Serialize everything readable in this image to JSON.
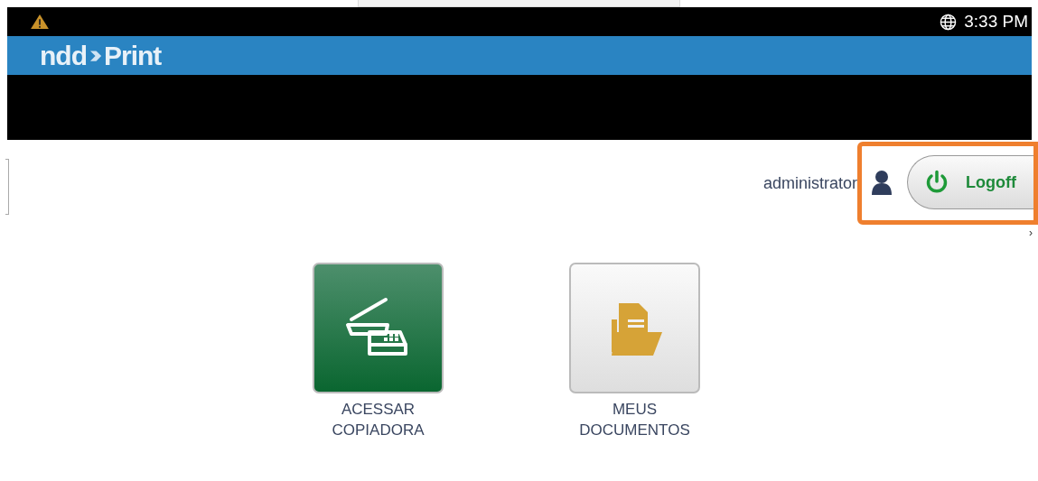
{
  "status_bar": {
    "time": "3:33 PM",
    "warning": true
  },
  "brand": {
    "logo_prefix": "ndd",
    "logo_suffix": "Print"
  },
  "user": {
    "name": "administrator",
    "logoff_label": "Logoff",
    "highlighted": true
  },
  "next_arrow": "›",
  "tiles": [
    {
      "kind": "copier",
      "label_lines": [
        "ACESSAR",
        "COPIADORA"
      ]
    },
    {
      "kind": "documents",
      "label_lines": [
        "MEUS",
        "DOCUMENTOS"
      ]
    }
  ]
}
